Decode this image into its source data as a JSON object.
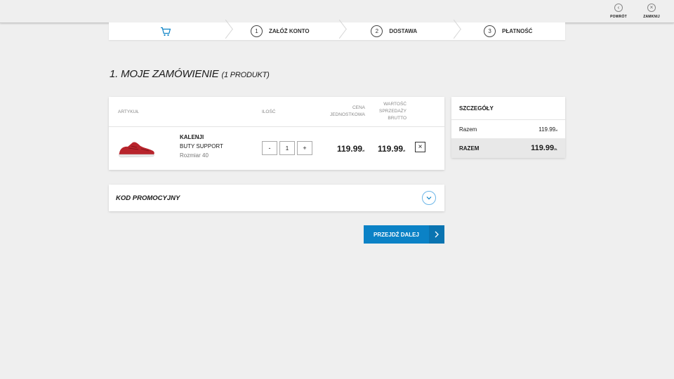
{
  "topbar": {
    "back_label": "POWRÓT",
    "close_label": "ZAMKNIJ"
  },
  "steps": [
    {
      "num": "",
      "label": ""
    },
    {
      "num": "1",
      "label": "ZAŁÓŻ KONTO"
    },
    {
      "num": "2",
      "label": "DOSTAWA"
    },
    {
      "num": "3",
      "label": "PŁATNOŚĆ"
    }
  ],
  "page": {
    "title": "1. MOJE ZAMÓWIENIE",
    "count": "(1 PRODUKT)"
  },
  "cart": {
    "headers": {
      "article": "ARTYKUŁ",
      "quantity": "ILOŚĆ",
      "unit_price": "CENA JEDNOSTKOWA",
      "gross_total": "WARTOŚĆ SPRZEDAŻY BRUTTO"
    },
    "item": {
      "brand": "KALENJI",
      "name": "BUTY SUPPORT",
      "size": "Rozmiar 40",
      "quantity": "1",
      "minus": "-",
      "plus": "+",
      "unit_price": "119.99",
      "total_price": "119.99",
      "currency": "zł",
      "remove": "×"
    }
  },
  "summary": {
    "title": "SZCZEGÓŁY",
    "subtotal_label": "Razem",
    "subtotal_value": "119.99",
    "subtotal_currency": "zł",
    "total_label": "RAZEM",
    "total_value": "119.99",
    "total_currency": "ZŁ"
  },
  "promo": {
    "label": "KOD PROMOCYJNY"
  },
  "next": {
    "label": "PRZEJDŹ DALEJ"
  },
  "colors": {
    "accent": "#0b82c6",
    "background": "#efefef",
    "shoe": "#b8242c"
  }
}
